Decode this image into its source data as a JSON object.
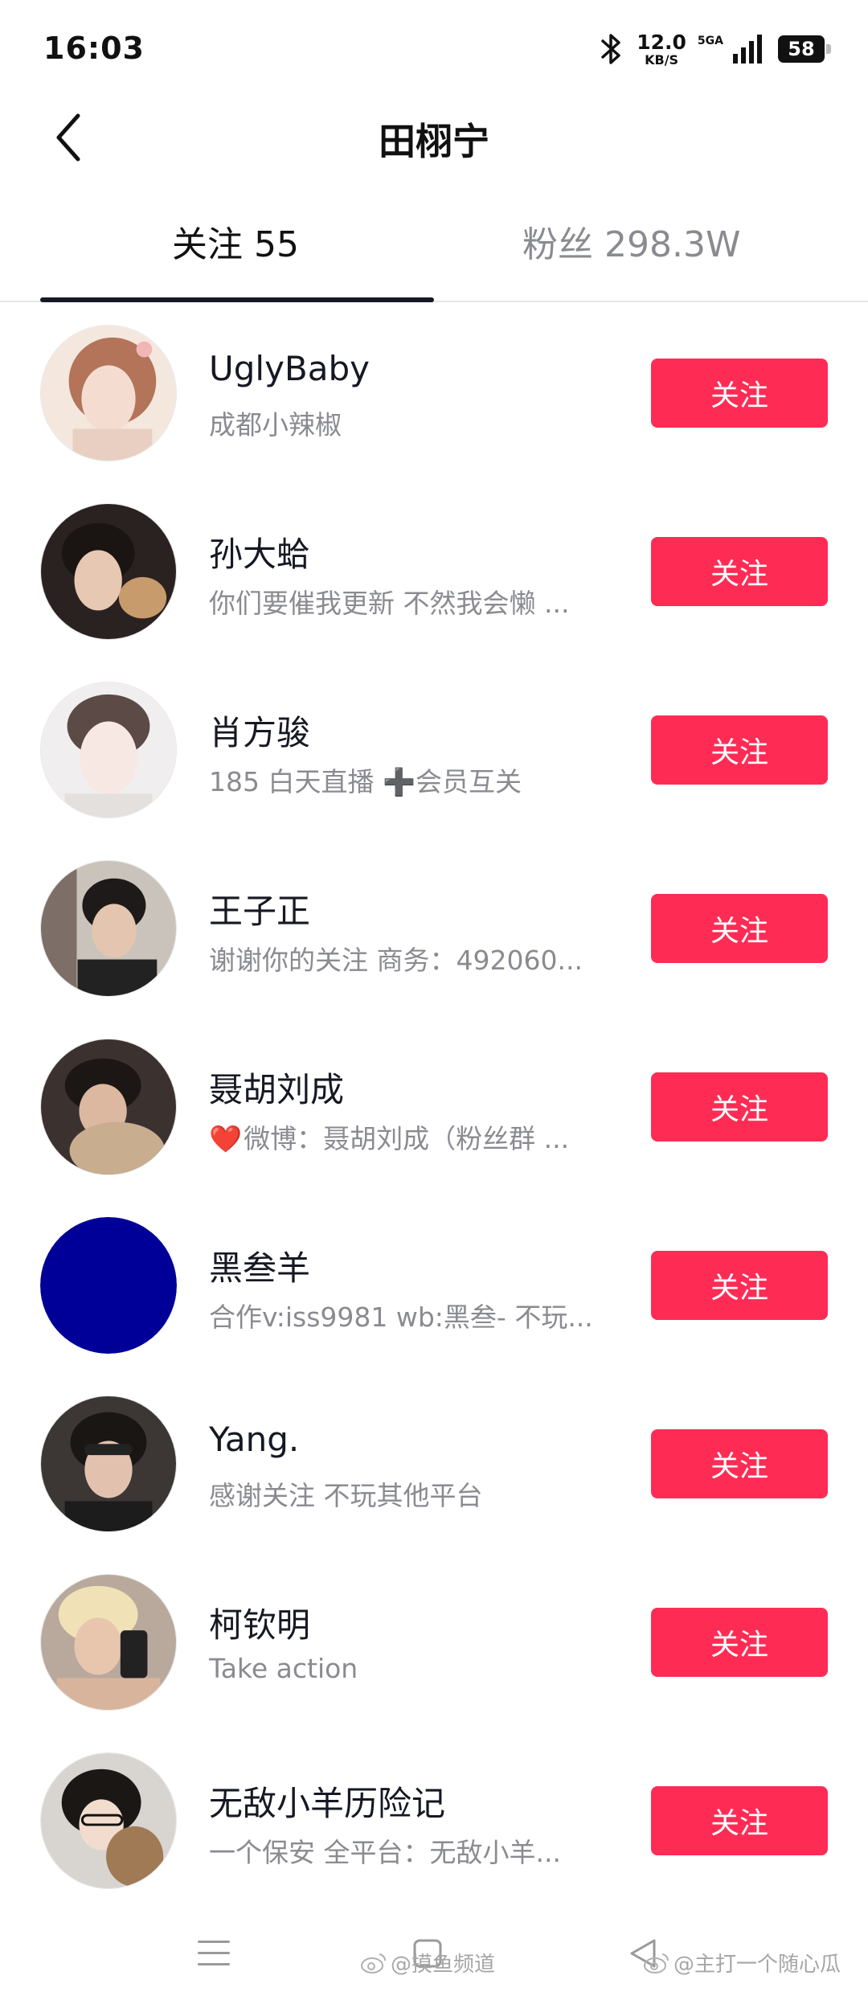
{
  "status_bar": {
    "time": "16:03",
    "net_speed": "12.0",
    "net_unit": "KB/S",
    "signal_label": "5GA",
    "battery": "58",
    "icons": [
      "bluetooth-icon",
      "signal-icon",
      "battery-icon"
    ]
  },
  "header": {
    "title": "田栩宁",
    "back_icon": "chevron-left-icon"
  },
  "tabs": [
    {
      "label": "关注 55",
      "active": true
    },
    {
      "label": "粉丝 298.3W",
      "active": false
    }
  ],
  "follow_label": "关注",
  "users": [
    {
      "name": "UglyBaby",
      "desc": "成都小辣椒"
    },
    {
      "name": "孙大蛤",
      "desc": "你们要催我更新 不然我会懒 ..."
    },
    {
      "name": "肖方骏",
      "desc": "185 白天直播 ➕会员互关"
    },
    {
      "name": "王子正",
      "desc": "谢谢你的关注 商务：492060..."
    },
    {
      "name": "聂胡刘成",
      "desc": "微博：聂胡刘成（粉丝群 ...",
      "heart": "❤️"
    },
    {
      "name": "黑叁羊",
      "desc": "合作v:iss9981 wb:黑叁- 不玩..."
    },
    {
      "name": "Yang.",
      "desc": "感谢关注 不玩其他平台"
    },
    {
      "name": "柯钦明",
      "desc": "Take action"
    },
    {
      "name": "无敌小羊历险记",
      "desc": "一个保安 全平台：无敌小羊..."
    }
  ],
  "nav": {
    "icons": [
      "menu-icon",
      "home-square-icon",
      "back-triangle-icon"
    ]
  },
  "watermarks": [
    "@摸鱼频道",
    "@主打一个随心瓜"
  ],
  "colors": {
    "accent": "#fe2c55",
    "text_primary": "#161823",
    "text_secondary": "#8a8b91",
    "avatar_blue": "#000099"
  }
}
